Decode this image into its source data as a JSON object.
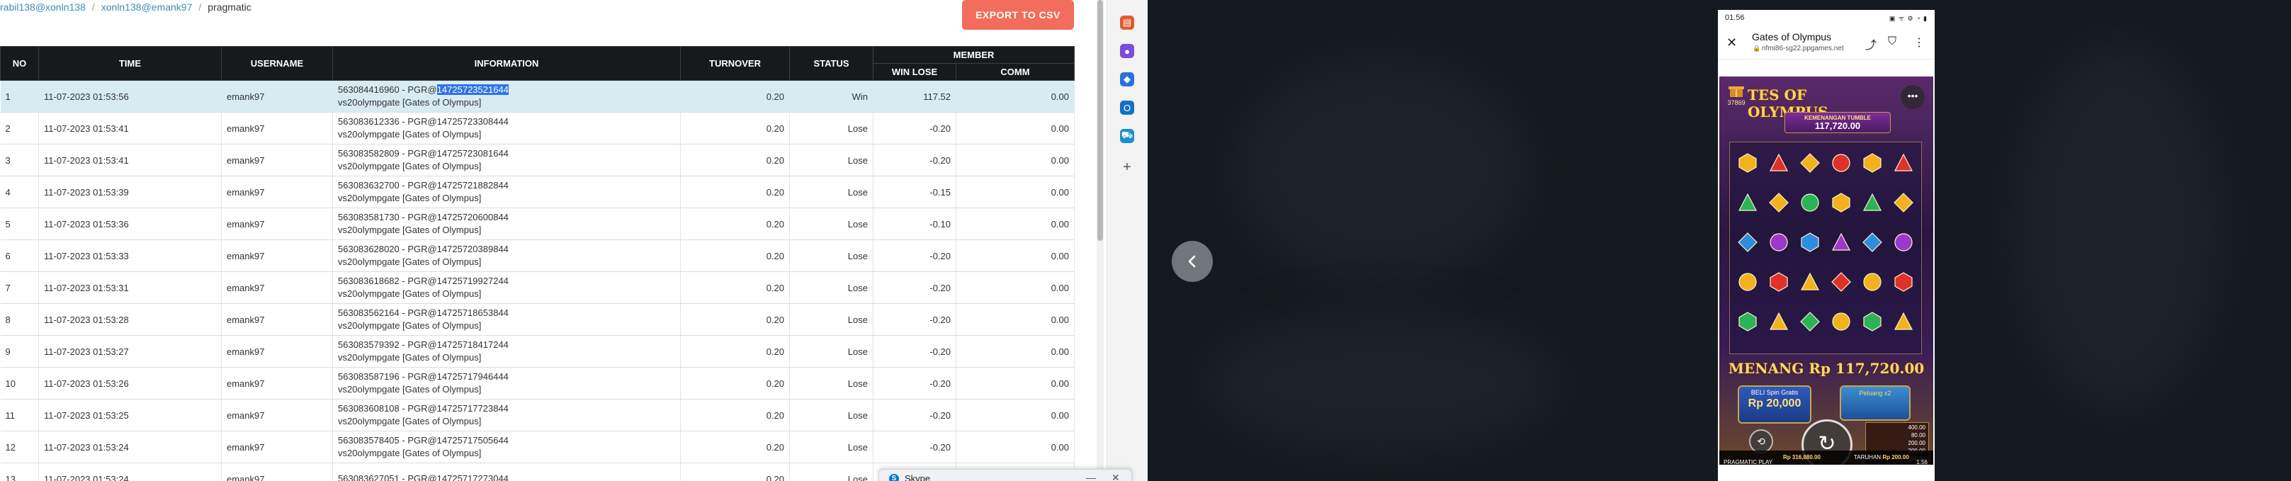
{
  "breadcrumb": {
    "items": [
      "rabil138@xonln138",
      "xonln138@emank97",
      "pragmatic"
    ]
  },
  "export_button": "EXPORT TO CSV",
  "table": {
    "headers": {
      "no": "NO",
      "time": "TIME",
      "username": "USERNAME",
      "information": "INFORMATION",
      "turnover": "TURNOVER",
      "status": "STATUS",
      "member": "MEMBER",
      "win_lose": "WIN LOSE",
      "comm": "COMM"
    },
    "rows": [
      {
        "no": "1",
        "time": "11-07-2023 01:53:56",
        "username": "emank97",
        "info_prefix": "563084416960 - PGR@",
        "info_sel": "14725723521644",
        "info_line2": "vs20olympgate [Gates of Olympus]",
        "turnover": "0.20",
        "status": "Win",
        "win_lose": "117.52",
        "comm": "0.00"
      },
      {
        "no": "2",
        "time": "11-07-2023 01:53:41",
        "username": "emank97",
        "info_prefix": "563083612336 - PGR@14725723308444",
        "info_sel": "",
        "info_line2": "vs20olympgate [Gates of Olympus]",
        "turnover": "0.20",
        "status": "Lose",
        "win_lose": "-0.20",
        "comm": "0.00"
      },
      {
        "no": "3",
        "time": "11-07-2023 01:53:41",
        "username": "emank97",
        "info_prefix": "563083582809 - PGR@14725723081644",
        "info_sel": "",
        "info_line2": "vs20olympgate [Gates of Olympus]",
        "turnover": "0.20",
        "status": "Lose",
        "win_lose": "-0.20",
        "comm": "0.00"
      },
      {
        "no": "4",
        "time": "11-07-2023 01:53:39",
        "username": "emank97",
        "info_prefix": "563083632700 - PGR@14725721882844",
        "info_sel": "",
        "info_line2": "vs20olympgate [Gates of Olympus]",
        "turnover": "0.20",
        "status": "Lose",
        "win_lose": "-0.15",
        "comm": "0.00"
      },
      {
        "no": "5",
        "time": "11-07-2023 01:53:36",
        "username": "emank97",
        "info_prefix": "563083581730 - PGR@14725720600844",
        "info_sel": "",
        "info_line2": "vs20olympgate [Gates of Olympus]",
        "turnover": "0.20",
        "status": "Lose",
        "win_lose": "-0.10",
        "comm": "0.00"
      },
      {
        "no": "6",
        "time": "11-07-2023 01:53:33",
        "username": "emank97",
        "info_prefix": "563083628020 - PGR@14725720389844",
        "info_sel": "",
        "info_line2": "vs20olympgate [Gates of Olympus]",
        "turnover": "0.20",
        "status": "Lose",
        "win_lose": "-0.20",
        "comm": "0.00"
      },
      {
        "no": "7",
        "time": "11-07-2023 01:53:31",
        "username": "emank97",
        "info_prefix": "563083618682 - PGR@14725719927244",
        "info_sel": "",
        "info_line2": "vs20olympgate [Gates of Olympus]",
        "turnover": "0.20",
        "status": "Lose",
        "win_lose": "-0.20",
        "comm": "0.00"
      },
      {
        "no": "8",
        "time": "11-07-2023 01:53:28",
        "username": "emank97",
        "info_prefix": "563083562164 - PGR@14725718653844",
        "info_sel": "",
        "info_line2": "vs20olympgate [Gates of Olympus]",
        "turnover": "0.20",
        "status": "Lose",
        "win_lose": "-0.20",
        "comm": "0.00"
      },
      {
        "no": "9",
        "time": "11-07-2023 01:53:27",
        "username": "emank97",
        "info_prefix": "563083579392 - PGR@14725718417244",
        "info_sel": "",
        "info_line2": "vs20olympgate [Gates of Olympus]",
        "turnover": "0.20",
        "status": "Lose",
        "win_lose": "-0.20",
        "comm": "0.00"
      },
      {
        "no": "10",
        "time": "11-07-2023 01:53:26",
        "username": "emank97",
        "info_prefix": "563083587196 - PGR@14725717946444",
        "info_sel": "",
        "info_line2": "vs20olympgate [Gates of Olympus]",
        "turnover": "0.20",
        "status": "Lose",
        "win_lose": "-0.20",
        "comm": "0.00"
      },
      {
        "no": "11",
        "time": "11-07-2023 01:53:25",
        "username": "emank97",
        "info_prefix": "563083608108 - PGR@14725717723844",
        "info_sel": "",
        "info_line2": "vs20olympgate [Gates of Olympus]",
        "turnover": "0.20",
        "status": "Lose",
        "win_lose": "-0.20",
        "comm": "0.00"
      },
      {
        "no": "12",
        "time": "11-07-2023 01:53:24",
        "username": "emank97",
        "info_prefix": "563083578405 - PGR@14725717505644",
        "info_sel": "",
        "info_line2": "vs20olympgate [Gates of Olympus]",
        "turnover": "0.20",
        "status": "Lose",
        "win_lose": "-0.20",
        "comm": "0.00"
      },
      {
        "no": "13",
        "time": "11-07-2023 01:53:24",
        "username": "emank97",
        "info_prefix": "563083627051 - PGR@14725717273044",
        "info_sel": "",
        "info_line2": "",
        "turnover": "0.20",
        "status": "Lose",
        "win_lose": "",
        "comm": ""
      }
    ]
  },
  "skype": {
    "title": "Skype",
    "minimize": "—",
    "close": "✕"
  },
  "phone": {
    "status_time": "01.56",
    "status_icons": "▣ ᯤ ⚙ ◔ ▮",
    "page_title": "Gates of Olympus",
    "page_url": "nfmi86-sg22.ppgames.net",
    "game": {
      "logo_text": "TES OF OLYMPUS",
      "badge_number": "37869",
      "tumble_label": "KEMENANGAN TUMBLE",
      "tumble_amount": "117,720.00",
      "win_text": "MENANG Rp 117,720.00",
      "buy_label": "BELI Spin Gratis",
      "buy_price": "Rp 20,000",
      "double_label": "Peluang x2",
      "paytable": [
        "400.00",
        "80.00",
        "200.00",
        "200.00",
        "160.00"
      ],
      "credit_label": "Rp 316,880.00",
      "bet_label": "TARUHAN",
      "bet_value": "Rp 200.00",
      "provider": "PRAGMATIC PLAY",
      "clock": "1:56"
    }
  },
  "colors": {
    "export_button": "#f26d5b",
    "header_bg": "#17191d",
    "win": "#3aa845",
    "lose": "#e8403c",
    "highlight_row": "#d6ecf1",
    "dark_desktop": "#141a1f"
  }
}
